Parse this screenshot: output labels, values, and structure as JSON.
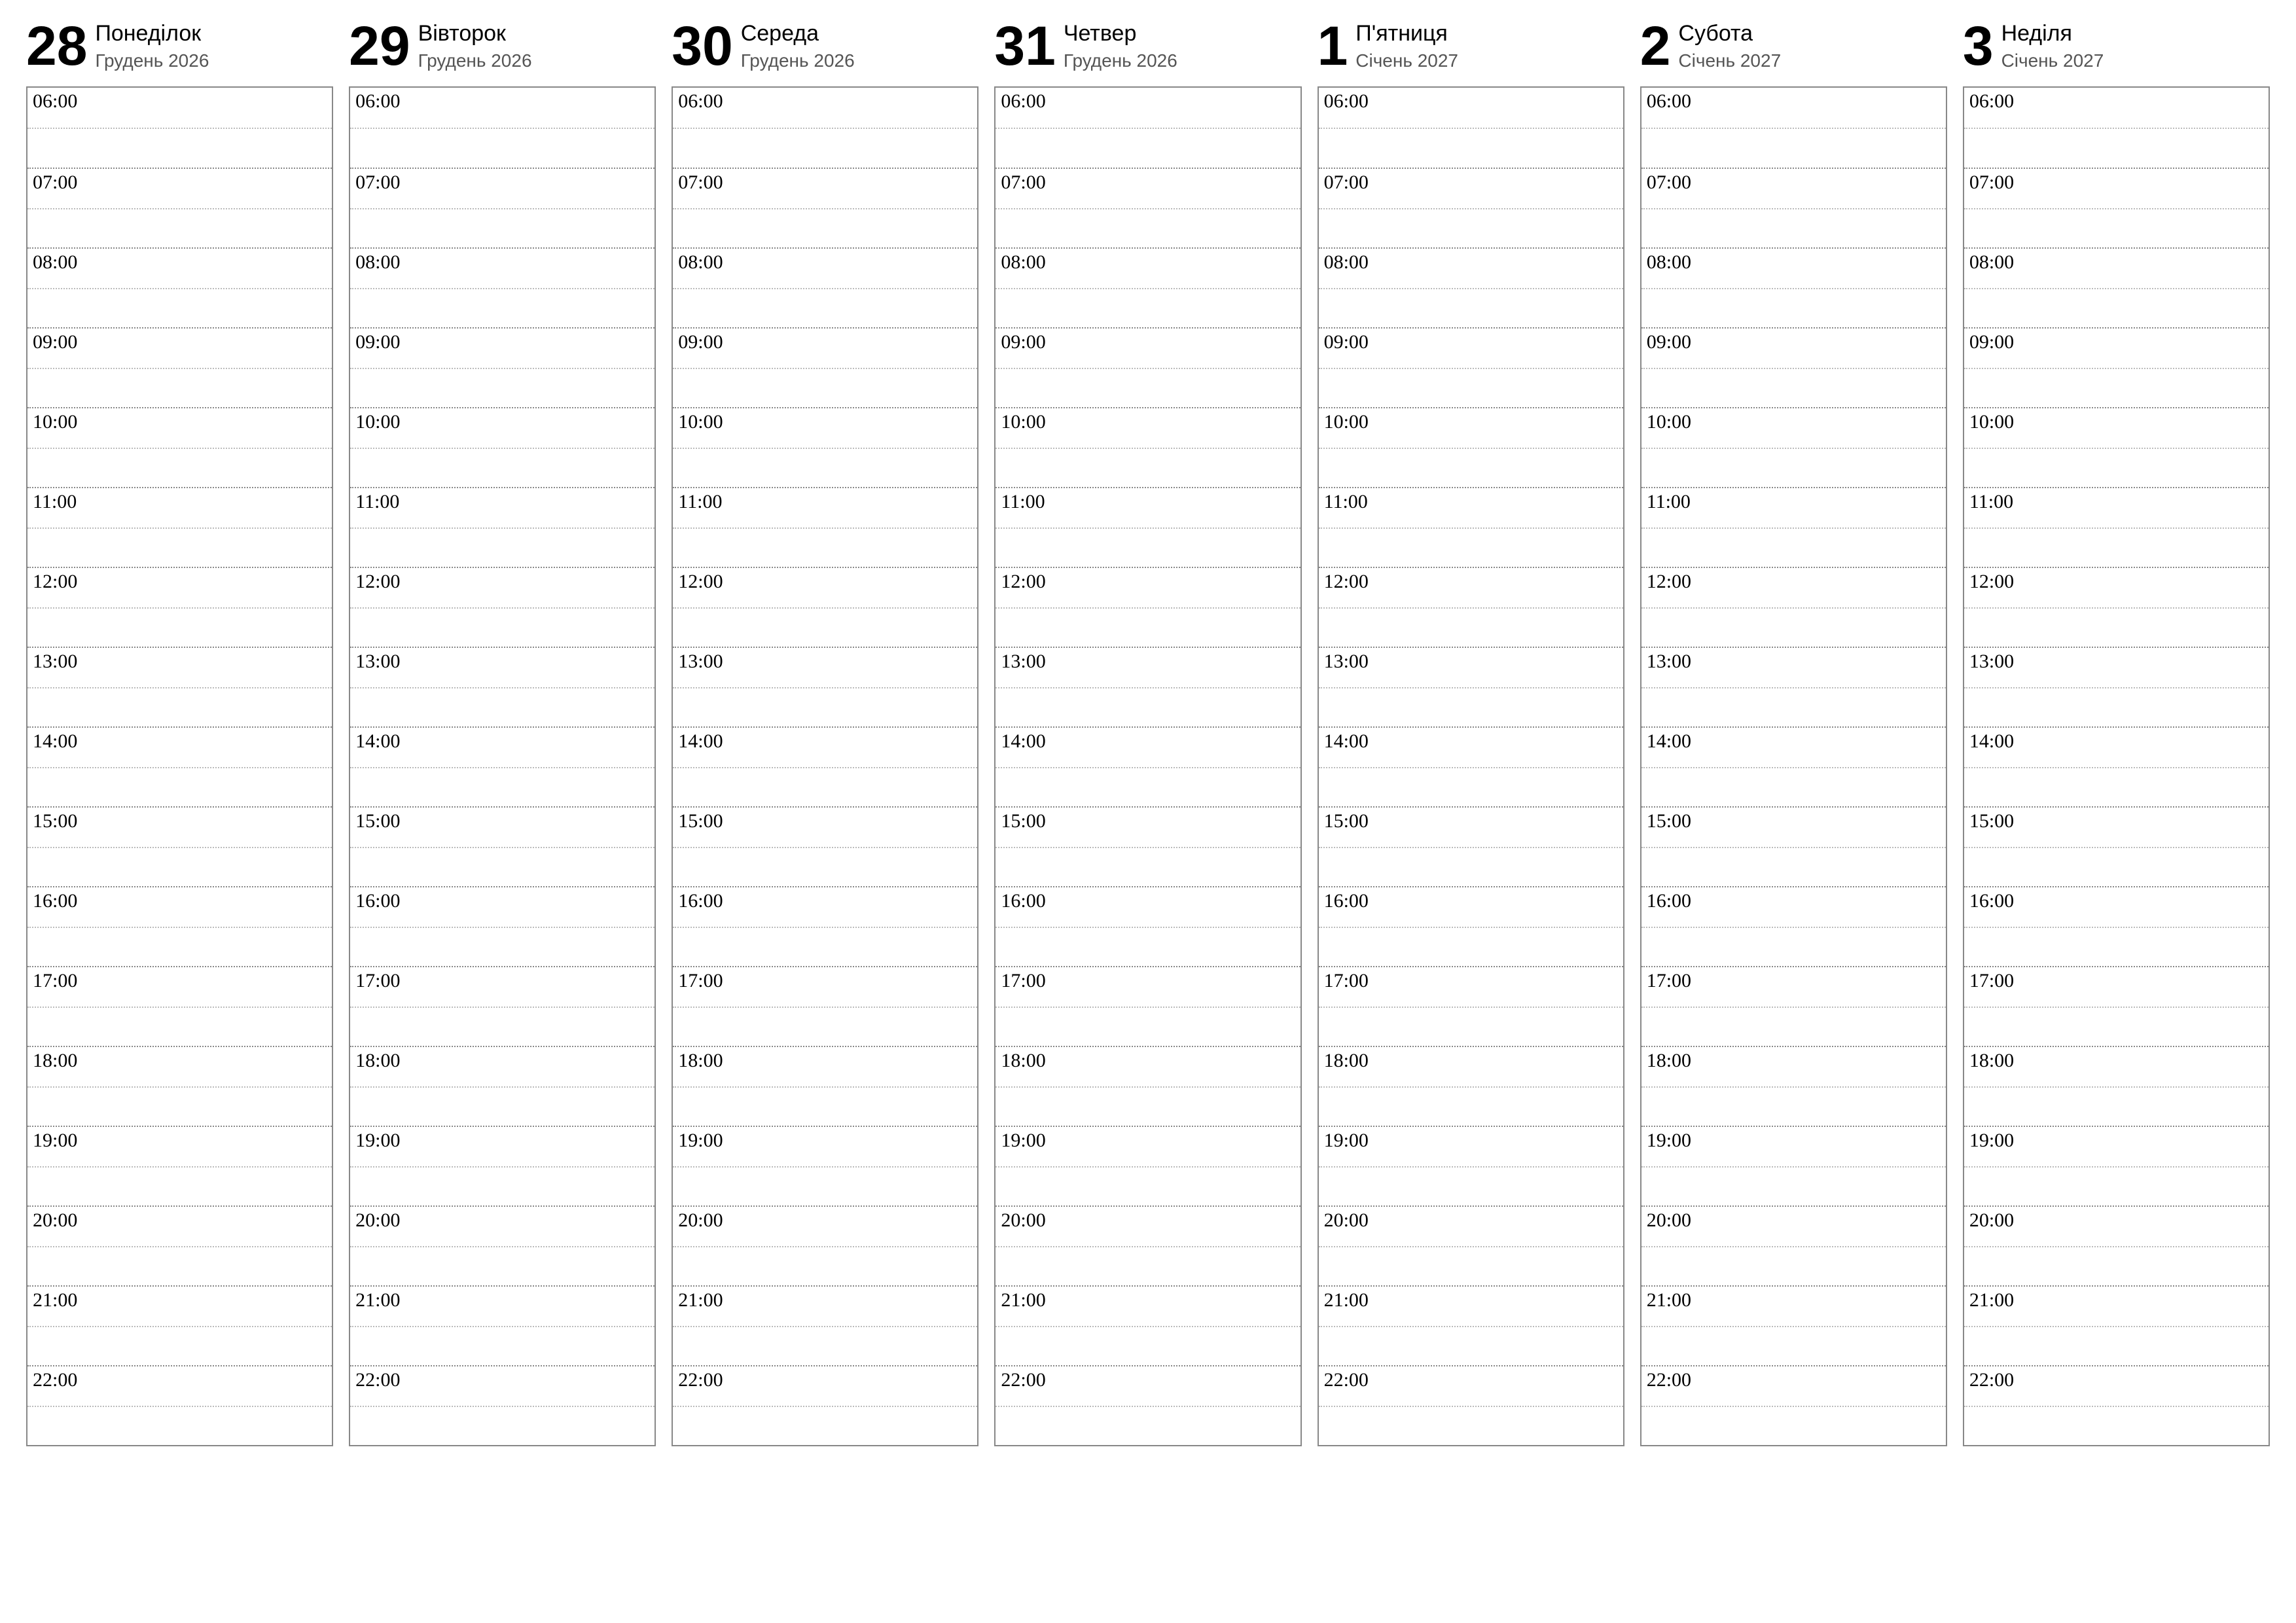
{
  "hours": [
    "06:00",
    "07:00",
    "08:00",
    "09:00",
    "10:00",
    "11:00",
    "12:00",
    "13:00",
    "14:00",
    "15:00",
    "16:00",
    "17:00",
    "18:00",
    "19:00",
    "20:00",
    "21:00",
    "22:00"
  ],
  "days": [
    {
      "num": "28",
      "name": "Понеділок",
      "sub": "Грудень 2026"
    },
    {
      "num": "29",
      "name": "Вівторок",
      "sub": "Грудень 2026"
    },
    {
      "num": "30",
      "name": "Середа",
      "sub": "Грудень 2026"
    },
    {
      "num": "31",
      "name": "Четвер",
      "sub": "Грудень 2026"
    },
    {
      "num": "1",
      "name": "П'ятниця",
      "sub": "Січень 2027"
    },
    {
      "num": "2",
      "name": "Субота",
      "sub": "Січень 2027"
    },
    {
      "num": "3",
      "name": "Неділя",
      "sub": "Січень 2027"
    }
  ]
}
